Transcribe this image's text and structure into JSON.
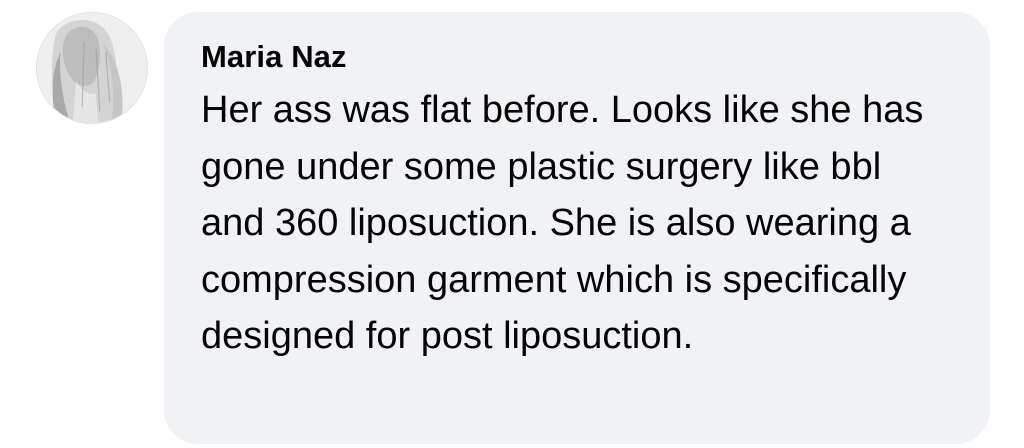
{
  "comment": {
    "author": "Maria Naz",
    "avatar_icon": "profile-photo",
    "text": "Her ass was flat before. Looks like she has gone under some plastic surgery like bbl and 360 liposuction. She is also wearing a compression garment which is specifically designed for post liposuction.",
    "bubble_color": "#f0f2f5",
    "text_color": "#050505"
  }
}
